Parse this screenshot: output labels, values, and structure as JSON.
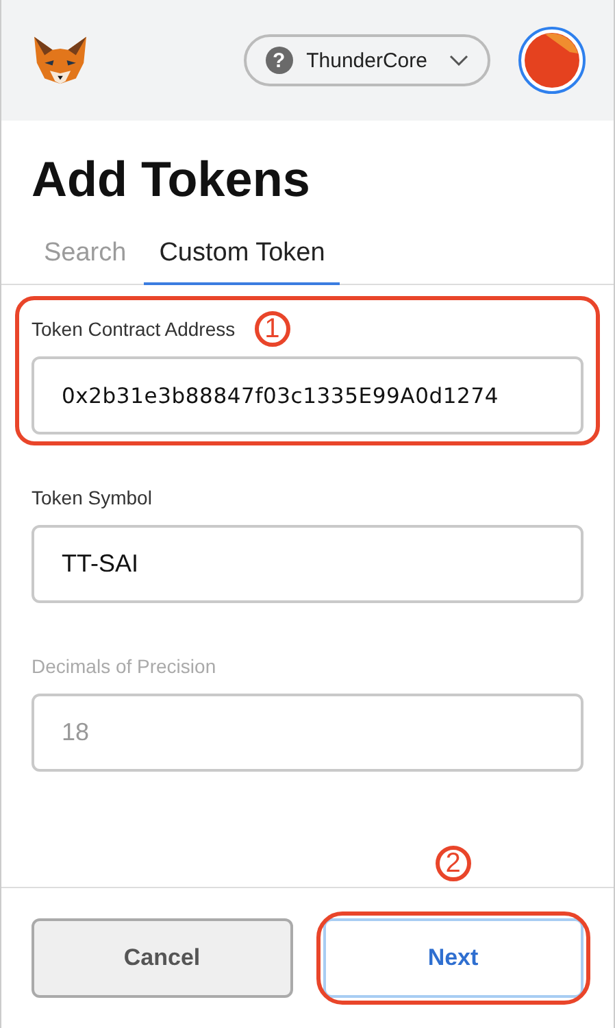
{
  "header": {
    "network": {
      "icon": "?",
      "name": "ThunderCore"
    }
  },
  "title": "Add Tokens",
  "tabs": [
    {
      "label": "Search",
      "selected": false
    },
    {
      "label": "Custom Token",
      "selected": true
    }
  ],
  "fields": [
    {
      "label": "Token Contract Address",
      "value": "0x2b31e3b88847f03c1335E99A0d1274",
      "disabled": false,
      "highlighted": true,
      "marker": "1"
    },
    {
      "label": "Token Symbol",
      "value": "TT-SAI",
      "disabled": false,
      "highlighted": false
    },
    {
      "label": "Decimals of Precision",
      "value": "18",
      "disabled": true,
      "highlighted": false
    }
  ],
  "buttons": [
    {
      "label": "Cancel",
      "kind": "secondary",
      "highlighted": false
    },
    {
      "label": "Next",
      "kind": "primary",
      "highlighted": true,
      "marker": "2"
    }
  ]
}
